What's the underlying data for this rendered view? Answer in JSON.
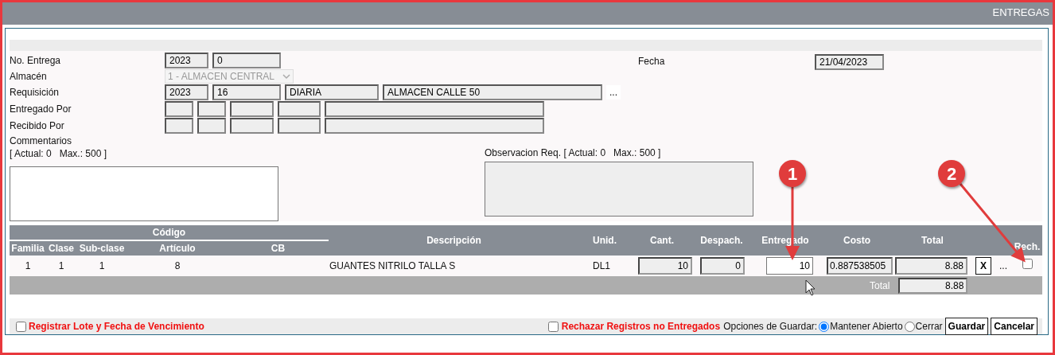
{
  "window": {
    "title": "ENTREGAS"
  },
  "header_fields": [
    {
      "label": "No. Entrega",
      "kind": "inputs",
      "values": [
        "2023",
        "0"
      ]
    },
    {
      "label": "Almacén",
      "kind": "select",
      "value": "1 - ALMACEN CENTRAL",
      "disabled": true
    },
    {
      "label": "Requisición",
      "kind": "inputs",
      "values": [
        "2023",
        "16",
        "DIARIA",
        "ALMACEN CALLE 50"
      ],
      "lookup": "..."
    },
    {
      "label": "Entregado Por",
      "kind": "blank_inputs"
    },
    {
      "label": "Recibido Por",
      "kind": "blank_inputs"
    }
  ],
  "fecha": {
    "label": "Fecha",
    "value": "21/04/2023"
  },
  "comments": {
    "label": "Commentarios",
    "counter": "[ Actual: 0   Max.: 500 ]"
  },
  "observacion": {
    "label": "Observacion Req. [ Actual: 0   Max.: 500 ]",
    "disabled": true
  },
  "table": {
    "group_heading": "Código",
    "columns": [
      "Familia",
      "Clase",
      "Sub-clase",
      "Artículo",
      "CB",
      "Descripción",
      "Unid.",
      "Cant.",
      "Despach.",
      "Entregado",
      "Costo",
      "Total",
      "Rech."
    ],
    "rows": [
      {
        "familia": "1",
        "clase": "1",
        "sub_clase": "1",
        "articulo": "8",
        "descripcion": "GUANTES NITRILO TALLA S",
        "unid": "DL1",
        "cant": "10",
        "despachado": "0",
        "entregado": "10",
        "costo": "0.887538505",
        "total": "8.88",
        "delete": "X",
        "more": "...",
        "rech": false
      }
    ],
    "total_row": {
      "label": "Total",
      "value": "8.88"
    }
  },
  "footer": {
    "lote": {
      "label": "Registrar Lote y Fecha de Vencimiento",
      "checked": false
    },
    "rechazar": {
      "label": "Rechazar Registros no Entregados",
      "checked": false
    },
    "options_label": "Opciones de Guardar:",
    "save_options": [
      {
        "label": "Mantener Abierto",
        "selected": true
      },
      {
        "label": "Cerrar",
        "selected": false
      }
    ],
    "buttons": [
      "Guardar",
      "Cancelar"
    ]
  },
  "annotations": [
    {
      "label": "1"
    },
    {
      "label": "2"
    }
  ]
}
